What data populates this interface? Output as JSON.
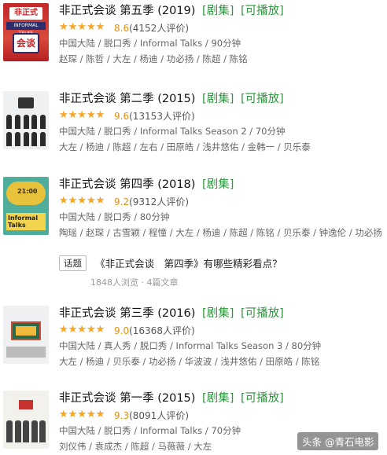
{
  "items": [
    {
      "title": "非正式会谈 第五季 (2019)",
      "tags": [
        "[剧集]",
        "[可播放]"
      ],
      "rating": 4.3,
      "score": "8.6",
      "count": "(4152人评价)",
      "meta": "中国大陆 / 脱口秀 / Informal Talks / 90分钟",
      "cast": "赵琛 / 陈哲 / 大左 / 杨迪 / 功必扬 / 陈超 / 陈铭",
      "poster_texts": [
        "非正式",
        "INFORMAL TALKS",
        "会谈"
      ]
    },
    {
      "title": "非正式会谈 第二季 (2015)",
      "tags": [
        "[剧集]",
        "[可播放]"
      ],
      "rating": 4.8,
      "score": "9.6",
      "count": "(13153人评价)",
      "meta": "中国大陆 / 脱口秀 / Informal Talks Season 2 / 70分钟",
      "cast": "大左 / 杨迪 / 陈超 / 左右 / 田原皓 / 浅井悠佑 / 金韩一 / 贝乐泰"
    },
    {
      "title": "非正式会谈 第四季 (2018)",
      "tags": [
        "[剧集]"
      ],
      "rating": 4.6,
      "score": "9.2",
      "count": "(9312人评价)",
      "meta": "中国大陆 / 脱口秀 / 80分钟",
      "cast": "陶瑶 / 赵琛 / 古雪颖 / 程憧 / 大左 / 杨迪 / 陈超 / 陈铭 / 贝乐泰 / 钟逸伦 / 功必扬",
      "poster_texts": [
        "21:00",
        "Informal Talks"
      ]
    },
    {
      "title": "非正式会谈 第三季 (2016)",
      "tags": [
        "[剧集]",
        "[可播放]"
      ],
      "rating": 4.5,
      "score": "9.0",
      "count": "(16368人评价)",
      "meta": "中国大陆 / 真人秀 / 脱口秀 / Informal Talks Season 3 / 80分钟",
      "cast": "大左 / 杨迪 / 贝乐泰 / 功必扬 / 华波波 / 浅井悠佑 / 田原皓 / 陈铭"
    },
    {
      "title": "非正式会谈 第一季 (2015)",
      "tags": [
        "[剧集]",
        "[可播放]"
      ],
      "rating": 4.65,
      "score": "9.3",
      "count": "(8091人评价)",
      "meta": "中国大陆 / 脱口秀 / Informal Talks / 70分钟",
      "cast": "刘仪伟 / 袁成杰 / 陈超 / 马薇薇 / 大左"
    }
  ],
  "topic": {
    "badge": "话题",
    "title": "《非正式会谈　第四季》有哪些精彩看点？",
    "sub": "1848人浏览 · 4篇文章"
  },
  "stars_glyph": "★★★★★",
  "watermark": "头条 @青石电影",
  "colors": {
    "tag_green": "#2e963d",
    "star_orange": "#f6a623",
    "score_orange": "#e09015",
    "meta_gray": "#666666"
  }
}
